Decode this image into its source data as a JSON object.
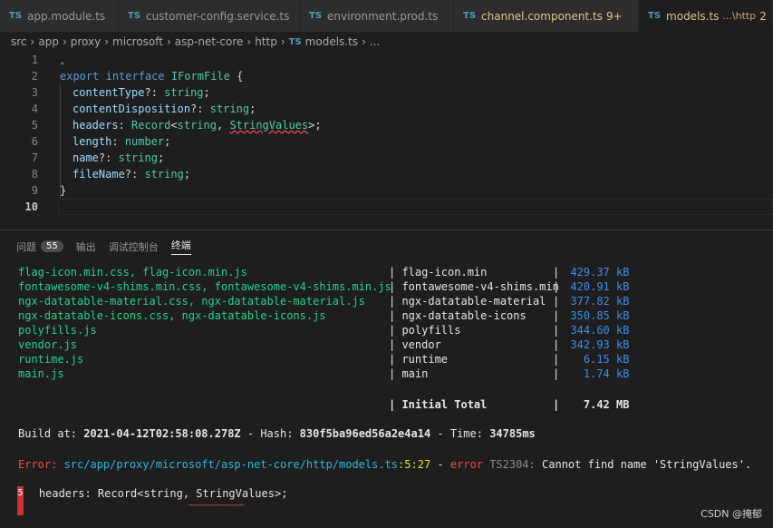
{
  "tabs": [
    {
      "name": "app.module.ts",
      "status": "",
      "active": false
    },
    {
      "name": "customer-config.service.ts",
      "status": "",
      "active": false
    },
    {
      "name": "environment.prod.ts",
      "status": "",
      "active": false
    },
    {
      "name": "channel.component.ts",
      "status": "9+",
      "active": false
    },
    {
      "name": "models.ts",
      "path": "...\\http",
      "status": "2",
      "active": true
    }
  ],
  "tab_icon": "TS",
  "breadcrumb": [
    "src",
    "app",
    "proxy",
    "microsoft",
    "asp-net-core",
    "http",
    "models.ts",
    "..."
  ],
  "editor": {
    "line_numbers": [
      "1",
      "2",
      "3",
      "4",
      "5",
      "6",
      "7",
      "8",
      "9",
      "10"
    ],
    "code": {
      "l2_kw1": "export",
      "l2_kw2": "interface",
      "l2_name": "IFormFile",
      "l2_brace": " {",
      "l3_prop": "contentType",
      "l3_rest": "?: ",
      "l3_type": "string",
      "l4_prop": "contentDisposition",
      "l4_rest": "?: ",
      "l4_type": "string",
      "l5_prop": "headers",
      "l5_rest": ": ",
      "l5_type1": "Record",
      "l5_lt": "<",
      "l5_type2": "string",
      "l5_comma": ", ",
      "l5_type3": "StringValues",
      "l5_end": ">;",
      "l6_prop": "length",
      "l6_rest": ": ",
      "l6_type": "number",
      "l7_prop": "name",
      "l7_rest": "?: ",
      "l7_type": "string",
      "l8_prop": "fileName",
      "l8_rest": "?: ",
      "l8_type": "string",
      "l9": "}",
      "semi": ";"
    }
  },
  "panel": {
    "tabs": [
      "问题",
      "输出",
      "调试控制台",
      "终端"
    ],
    "problems_count": "55",
    "active_tab": "终端"
  },
  "terminal": {
    "chunks": [
      {
        "files": "flag-icon.min.css, flag-icon.min.js",
        "name": "flag-icon.min",
        "size": "429.37 kB"
      },
      {
        "files": "fontawesome-v4-shims.min.css, fontawesome-v4-shims.min.js",
        "name": "fontawesome-v4-shims.min",
        "size": "420.91 kB"
      },
      {
        "files": "ngx-datatable-material.css, ngx-datatable-material.js",
        "name": "ngx-datatable-material",
        "size": "377.82 kB"
      },
      {
        "files": "ngx-datatable-icons.css, ngx-datatable-icons.js",
        "name": "ngx-datatable-icons",
        "size": "350.85 kB"
      },
      {
        "files": "polyfills.js",
        "name": "polyfills",
        "size": "344.60 kB"
      },
      {
        "files": "vendor.js",
        "name": "vendor",
        "size": "342.93 kB"
      },
      {
        "files": "runtime.js",
        "name": "runtime",
        "size": "6.15 kB"
      },
      {
        "files": "main.js",
        "name": "main",
        "size": "1.74 kB"
      }
    ],
    "total_label": "Initial Total",
    "total_size": "7.42 MB",
    "build_prefix": "Build at: ",
    "build_date": "2021-04-12T02:58:08.278Z",
    "hash_prefix": " - Hash: ",
    "hash": "830f5ba96ed56a2e4a14",
    "time_prefix": " - Time: ",
    "time": "34785ms",
    "error_label": "Error: ",
    "error_file": "src/app/proxy/microsoft/asp-net-core/http/models.ts",
    "error_loc": ":5:27",
    "error_dash": " - ",
    "error_word": "error",
    "error_code": " TS2304: ",
    "error_msg": "Cannot find name 'StringValues'.",
    "error_line_no": "5",
    "error_snippet": "    headers: Record<string, StringValues>;",
    "error_underline": "~~~~~~~~~~~~"
  },
  "watermark": "CSDN @掩郁"
}
